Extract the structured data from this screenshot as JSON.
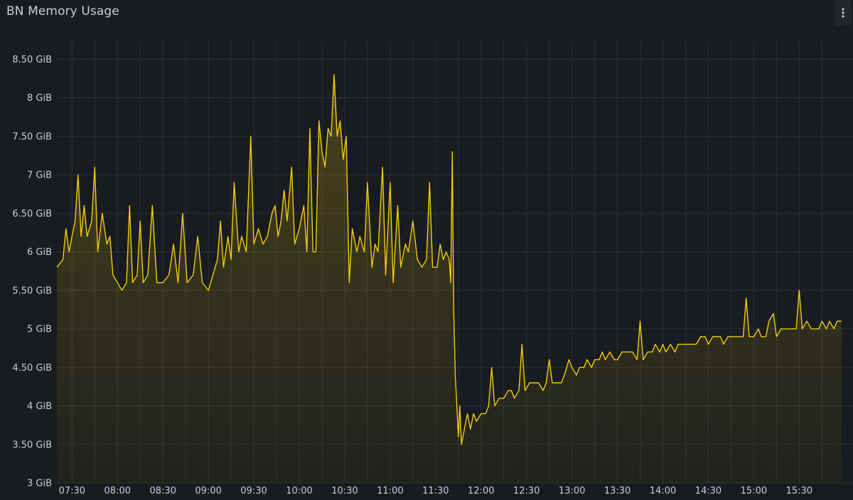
{
  "panel": {
    "title": "BN Memory Usage",
    "menu_icon": "kebab-menu-icon"
  },
  "colors": {
    "background": "#181b1f",
    "grid": "#2c2f35",
    "series": "#f2cc0c",
    "text": "#ccccdc"
  },
  "chart_data": {
    "type": "area",
    "title": "BN Memory Usage",
    "xlabel": "",
    "ylabel": "",
    "x_ticks": [
      "07:30",
      "08:00",
      "08:30",
      "09:00",
      "09:30",
      "10:00",
      "10:30",
      "11:00",
      "11:30",
      "12:00",
      "12:30",
      "13:00",
      "13:30",
      "14:00",
      "14:30",
      "15:00",
      "15:30"
    ],
    "y_ticks": [
      "3 GiB",
      "3.50 GiB",
      "4 GiB",
      "4.50 GiB",
      "5 GiB",
      "5.50 GiB",
      "6 GiB",
      "6.50 GiB",
      "7 GiB",
      "7.50 GiB",
      "8 GiB",
      "8.50 GiB"
    ],
    "x_range": [
      "07:20",
      "15:58"
    ],
    "y_range_gib": [
      3,
      8.9
    ],
    "grid": true,
    "legend": "none",
    "series": [
      {
        "unit": "GiB",
        "points": [
          [
            "07:20",
            5.8
          ],
          [
            "07:24",
            5.9
          ],
          [
            "07:26",
            6.3
          ],
          [
            "07:28",
            6.0
          ],
          [
            "07:30",
            6.2
          ],
          [
            "07:32",
            6.4
          ],
          [
            "07:34",
            7.0
          ],
          [
            "07:36",
            6.2
          ],
          [
            "07:38",
            6.6
          ],
          [
            "07:40",
            6.2
          ],
          [
            "07:43",
            6.4
          ],
          [
            "07:45",
            7.1
          ],
          [
            "07:47",
            6.0
          ],
          [
            "07:50",
            6.5
          ],
          [
            "07:53",
            6.1
          ],
          [
            "07:55",
            6.2
          ],
          [
            "07:57",
            5.7
          ],
          [
            "08:00",
            5.6
          ],
          [
            "08:03",
            5.5
          ],
          [
            "08:06",
            5.6
          ],
          [
            "08:08",
            6.6
          ],
          [
            "08:10",
            5.6
          ],
          [
            "08:13",
            5.7
          ],
          [
            "08:15",
            6.4
          ],
          [
            "08:17",
            5.6
          ],
          [
            "08:20",
            5.7
          ],
          [
            "08:23",
            6.6
          ],
          [
            "08:26",
            5.6
          ],
          [
            "08:30",
            5.6
          ],
          [
            "08:34",
            5.7
          ],
          [
            "08:37",
            6.1
          ],
          [
            "08:40",
            5.6
          ],
          [
            "08:43",
            6.5
          ],
          [
            "08:46",
            5.6
          ],
          [
            "08:50",
            5.7
          ],
          [
            "08:53",
            6.2
          ],
          [
            "08:56",
            5.6
          ],
          [
            "09:00",
            5.5
          ],
          [
            "09:03",
            5.7
          ],
          [
            "09:06",
            5.9
          ],
          [
            "09:08",
            6.4
          ],
          [
            "09:10",
            5.8
          ],
          [
            "09:13",
            6.2
          ],
          [
            "09:15",
            5.9
          ],
          [
            "09:17",
            6.9
          ],
          [
            "09:20",
            6.0
          ],
          [
            "09:22",
            6.2
          ],
          [
            "09:25",
            6.0
          ],
          [
            "09:28",
            7.5
          ],
          [
            "09:30",
            6.1
          ],
          [
            "09:33",
            6.3
          ],
          [
            "09:36",
            6.1
          ],
          [
            "09:39",
            6.2
          ],
          [
            "09:42",
            6.5
          ],
          [
            "09:44",
            6.6
          ],
          [
            "09:46",
            6.2
          ],
          [
            "09:48",
            6.4
          ],
          [
            "09:50",
            6.8
          ],
          [
            "09:52",
            6.4
          ],
          [
            "09:55",
            7.1
          ],
          [
            "09:57",
            6.1
          ],
          [
            "10:00",
            6.3
          ],
          [
            "10:03",
            6.6
          ],
          [
            "10:05",
            6.0
          ],
          [
            "10:07",
            7.6
          ],
          [
            "10:09",
            6.0
          ],
          [
            "10:11",
            6.0
          ],
          [
            "10:13",
            7.7
          ],
          [
            "10:15",
            7.3
          ],
          [
            "10:17",
            7.1
          ],
          [
            "10:19",
            7.6
          ],
          [
            "10:21",
            7.5
          ],
          [
            "10:23",
            8.3
          ],
          [
            "10:25",
            7.5
          ],
          [
            "10:27",
            7.7
          ],
          [
            "10:29",
            7.2
          ],
          [
            "10:31",
            7.5
          ],
          [
            "10:33",
            5.6
          ],
          [
            "10:35",
            6.3
          ],
          [
            "10:38",
            6.0
          ],
          [
            "10:40",
            6.2
          ],
          [
            "10:43",
            6.0
          ],
          [
            "10:45",
            6.9
          ],
          [
            "10:48",
            5.8
          ],
          [
            "10:50",
            6.1
          ],
          [
            "10:52",
            6.0
          ],
          [
            "10:55",
            7.1
          ],
          [
            "10:57",
            5.7
          ],
          [
            "11:00",
            6.9
          ],
          [
            "11:02",
            5.6
          ],
          [
            "11:05",
            6.6
          ],
          [
            "11:07",
            5.8
          ],
          [
            "11:10",
            6.1
          ],
          [
            "11:12",
            6.0
          ],
          [
            "11:15",
            6.4
          ],
          [
            "11:18",
            5.9
          ],
          [
            "11:21",
            5.8
          ],
          [
            "11:24",
            5.9
          ],
          [
            "11:26",
            6.9
          ],
          [
            "11:28",
            5.8
          ],
          [
            "11:31",
            5.8
          ],
          [
            "11:33",
            6.1
          ],
          [
            "11:35",
            5.9
          ],
          [
            "11:37",
            6.0
          ],
          [
            "11:39",
            5.9
          ],
          [
            "11:40",
            5.6
          ],
          [
            "11:41",
            7.3
          ],
          [
            "11:42",
            5.2
          ],
          [
            "11:43",
            4.4
          ],
          [
            "11:44",
            4.0
          ],
          [
            "11:45",
            3.6
          ],
          [
            "11:46",
            4.0
          ],
          [
            "11:47",
            3.5
          ],
          [
            "11:49",
            3.7
          ],
          [
            "11:51",
            3.9
          ],
          [
            "11:53",
            3.7
          ],
          [
            "11:55",
            3.9
          ],
          [
            "11:57",
            3.8
          ],
          [
            "12:00",
            3.9
          ],
          [
            "12:03",
            3.9
          ],
          [
            "12:05",
            4.0
          ],
          [
            "12:07",
            4.5
          ],
          [
            "12:09",
            4.0
          ],
          [
            "12:12",
            4.1
          ],
          [
            "12:15",
            4.1
          ],
          [
            "12:18",
            4.2
          ],
          [
            "12:20",
            4.2
          ],
          [
            "12:22",
            4.1
          ],
          [
            "12:25",
            4.2
          ],
          [
            "12:27",
            4.8
          ],
          [
            "12:29",
            4.2
          ],
          [
            "12:32",
            4.3
          ],
          [
            "12:35",
            4.3
          ],
          [
            "12:38",
            4.3
          ],
          [
            "12:41",
            4.2
          ],
          [
            "12:43",
            4.3
          ],
          [
            "12:45",
            4.6
          ],
          [
            "12:47",
            4.3
          ],
          [
            "12:50",
            4.3
          ],
          [
            "12:53",
            4.3
          ],
          [
            "12:55",
            4.4
          ],
          [
            "12:58",
            4.6
          ],
          [
            "13:00",
            4.5
          ],
          [
            "13:03",
            4.4
          ],
          [
            "13:05",
            4.5
          ],
          [
            "13:08",
            4.5
          ],
          [
            "13:10",
            4.6
          ],
          [
            "13:13",
            4.5
          ],
          [
            "13:15",
            4.6
          ],
          [
            "13:18",
            4.6
          ],
          [
            "13:20",
            4.7
          ],
          [
            "13:22",
            4.6
          ],
          [
            "13:25",
            4.7
          ],
          [
            "13:28",
            4.6
          ],
          [
            "13:30",
            4.6
          ],
          [
            "13:33",
            4.7
          ],
          [
            "13:35",
            4.7
          ],
          [
            "13:38",
            4.7
          ],
          [
            "13:40",
            4.7
          ],
          [
            "13:43",
            4.6
          ],
          [
            "13:45",
            5.1
          ],
          [
            "13:47",
            4.6
          ],
          [
            "13:50",
            4.7
          ],
          [
            "13:53",
            4.7
          ],
          [
            "13:55",
            4.8
          ],
          [
            "13:58",
            4.7
          ],
          [
            "14:00",
            4.8
          ],
          [
            "14:02",
            4.7
          ],
          [
            "14:05",
            4.8
          ],
          [
            "14:08",
            4.7
          ],
          [
            "14:10",
            4.8
          ],
          [
            "14:12",
            4.8
          ],
          [
            "14:15",
            4.8
          ],
          [
            "14:18",
            4.8
          ],
          [
            "14:20",
            4.8
          ],
          [
            "14:22",
            4.8
          ],
          [
            "14:25",
            4.9
          ],
          [
            "14:28",
            4.9
          ],
          [
            "14:30",
            4.8
          ],
          [
            "14:33",
            4.9
          ],
          [
            "14:35",
            4.9
          ],
          [
            "14:38",
            4.9
          ],
          [
            "14:40",
            4.8
          ],
          [
            "14:43",
            4.9
          ],
          [
            "14:45",
            4.9
          ],
          [
            "14:48",
            4.9
          ],
          [
            "14:50",
            4.9
          ],
          [
            "14:53",
            4.9
          ],
          [
            "14:55",
            5.4
          ],
          [
            "14:57",
            4.9
          ],
          [
            "15:00",
            4.9
          ],
          [
            "15:03",
            5.0
          ],
          [
            "15:05",
            4.9
          ],
          [
            "15:08",
            4.9
          ],
          [
            "15:10",
            5.1
          ],
          [
            "15:13",
            5.2
          ],
          [
            "15:15",
            4.9
          ],
          [
            "15:18",
            5.0
          ],
          [
            "15:20",
            5.0
          ],
          [
            "15:22",
            5.0
          ],
          [
            "15:25",
            5.0
          ],
          [
            "15:28",
            5.0
          ],
          [
            "15:30",
            5.5
          ],
          [
            "15:32",
            5.0
          ],
          [
            "15:35",
            5.1
          ],
          [
            "15:38",
            5.0
          ],
          [
            "15:40",
            5.0
          ],
          [
            "15:43",
            5.0
          ],
          [
            "15:45",
            5.1
          ],
          [
            "15:48",
            5.0
          ],
          [
            "15:50",
            5.1
          ],
          [
            "15:53",
            5.0
          ],
          [
            "15:55",
            5.1
          ],
          [
            "15:58",
            5.1
          ]
        ]
      }
    ]
  }
}
